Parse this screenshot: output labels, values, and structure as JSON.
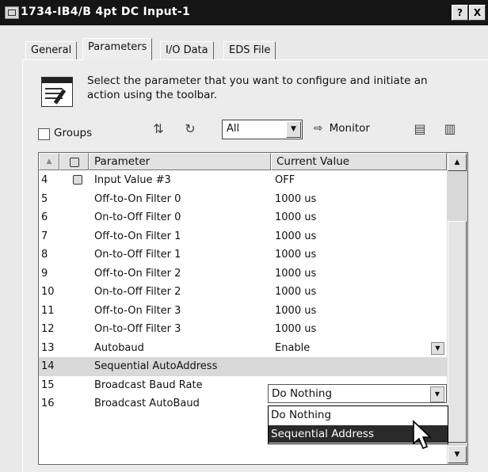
{
  "window": {
    "title": "1734-IB4/B 4pt DC Input-1",
    "help_button": "?",
    "close_button": "X"
  },
  "tabs": [
    {
      "label": "General",
      "active": false
    },
    {
      "label": "Parameters",
      "active": true
    },
    {
      "label": "I/O Data",
      "active": false
    },
    {
      "label": "EDS File",
      "active": false
    }
  ],
  "help": {
    "line1": "Select the parameter that you want to configure and initiate an",
    "line2": "action using the toolbar."
  },
  "toolbar": {
    "groups_label": "Groups",
    "groups_checked": false,
    "filter_value": "All",
    "monitor_label": "Monitor",
    "icons": [
      "parameter-sort-icon",
      "refresh-icon",
      "monitor-arrow-icon",
      "upload-icon",
      "download-icon"
    ]
  },
  "grid": {
    "columns": [
      "Parameter",
      "Current Value"
    ],
    "rows": [
      {
        "num": "4",
        "locked": true,
        "name": "Input Value #3",
        "value": "OFF"
      },
      {
        "num": "5",
        "locked": false,
        "name": "Off-to-On Filter 0",
        "value": "1000 us"
      },
      {
        "num": "6",
        "locked": false,
        "name": "On-to-Off Filter 0",
        "value": "1000 us"
      },
      {
        "num": "7",
        "locked": false,
        "name": "Off-to-On Filter 1",
        "value": "1000 us"
      },
      {
        "num": "8",
        "locked": false,
        "name": "On-to-Off Filter 1",
        "value": "1000 us"
      },
      {
        "num": "9",
        "locked": false,
        "name": "Off-to-On Filter 2",
        "value": "1000 us"
      },
      {
        "num": "10",
        "locked": false,
        "name": "On-to-Off Filter 2",
        "value": "1000 us"
      },
      {
        "num": "11",
        "locked": false,
        "name": "Off-to-On Filter 3",
        "value": "1000 us"
      },
      {
        "num": "12",
        "locked": false,
        "name": "On-to-Off Filter 3",
        "value": "1000 us"
      },
      {
        "num": "13",
        "locked": false,
        "name": "Autobaud",
        "value": "Enable"
      },
      {
        "num": "14",
        "locked": false,
        "name": "Sequential AutoAddress",
        "value": ""
      },
      {
        "num": "15",
        "locked": false,
        "name": "Broadcast Baud Rate",
        "value": ""
      },
      {
        "num": "16",
        "locked": false,
        "name": "Broadcast AutoBaud",
        "value": ""
      }
    ]
  },
  "dropdown": {
    "current": "Do Nothing",
    "options": [
      "Do Nothing",
      "Sequential Address"
    ],
    "highlighted": "Sequential Address"
  }
}
